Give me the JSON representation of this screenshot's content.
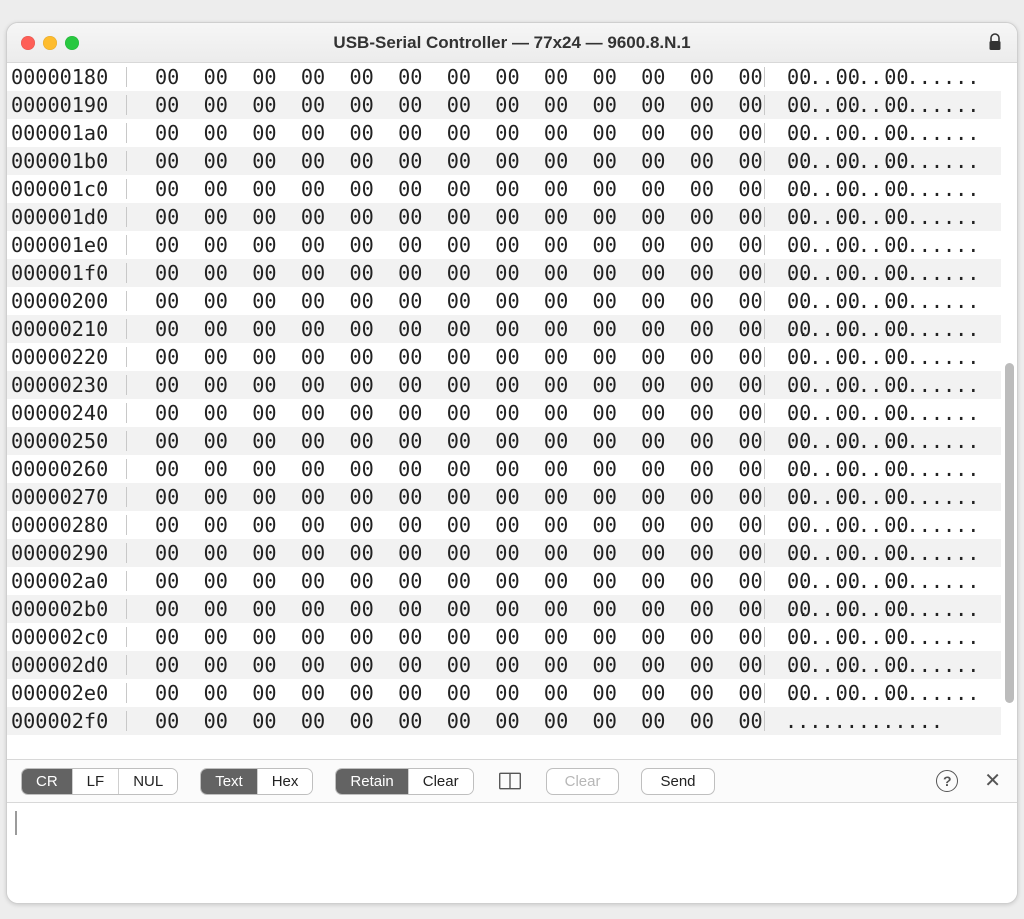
{
  "window": {
    "title": "USB-Serial Controller — 77x24 — 9600.8.N.1"
  },
  "dump": {
    "start_offset_hex": "00000180",
    "row_count": 24,
    "bytes_per_row": 16,
    "byte_value": "00",
    "ascii_placeholder": ".",
    "last_row_bytes": 13
  },
  "toolbar": {
    "line_ending": {
      "options": [
        "CR",
        "LF",
        "NUL"
      ],
      "active": "CR"
    },
    "encoding": {
      "options": [
        "Text",
        "Hex"
      ],
      "active": "Text"
    },
    "mode": {
      "options": [
        "Retain",
        "Clear"
      ],
      "active": "Retain"
    },
    "clear_button": "Clear",
    "send_button": "Send"
  },
  "input": {
    "value": ""
  }
}
